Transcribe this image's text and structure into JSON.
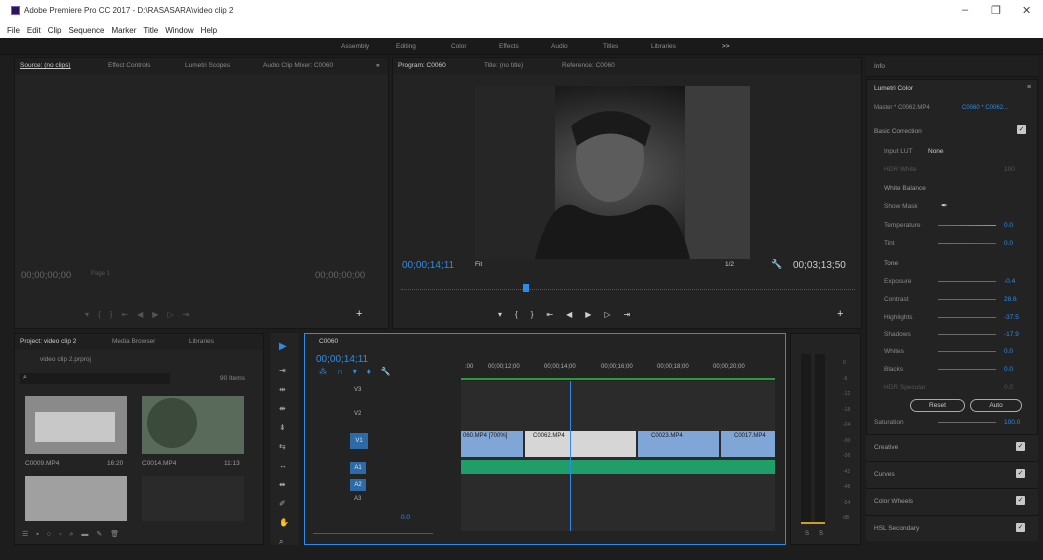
{
  "window": {
    "title": "Adobe Premiere Pro CC 2017 - D:\\RASASARA\\video clip 2",
    "minimize": "–",
    "maximize": "❐",
    "close": "✕"
  },
  "menu": [
    "File",
    "Edit",
    "Clip",
    "Sequence",
    "Marker",
    "Title",
    "Window",
    "Help"
  ],
  "workspaces": [
    "Assembly",
    "Editing",
    "Color",
    "Effects",
    "Audio",
    "Titles",
    "Libraries",
    ">>"
  ],
  "source": {
    "tabs": [
      "Source: (no clips)",
      "Effect Controls",
      "Lumetri Scopes",
      "Audio Clip Mixer: C0060"
    ],
    "tc_left": "00;00;00;00",
    "tc_right": "00;00;00;00",
    "page": "Page 1"
  },
  "program": {
    "tab": "Program: C0060",
    "title": "Title: (no title)",
    "ref": "Reference: C0060",
    "tc": "00;00;14;11",
    "fit": "Fit",
    "res": "1/2",
    "duration": "00;03;13;50"
  },
  "project": {
    "tabs": [
      "Project: video clip 2",
      "Media Browser",
      "Libraries"
    ],
    "file": "video clip 2.prproj",
    "count": "90 Items",
    "clips": [
      {
        "name": "C0009.MP4",
        "dur": "16:20"
      },
      {
        "name": "C0014.MP4",
        "dur": "11:13"
      }
    ]
  },
  "timeline": {
    "tab": "C0060",
    "tc": "00;00;14;11",
    "ruler": [
      ":00",
      "00;00;12;00",
      "00;00;14;00",
      "00;00;16;00",
      "00;00;18;00",
      "00;00;20;00"
    ],
    "video_tracks": [
      "V3",
      "V2",
      "V1"
    ],
    "audio_tracks": [
      "A1",
      "A2",
      "A3"
    ],
    "master": "0.0",
    "clips": [
      "060.MP4 [700%]",
      "C0062.MP4",
      "C0023.MP4",
      "C0017.MP4"
    ]
  },
  "meter": {
    "ticks": [
      "0",
      "-6",
      "-12",
      "-18",
      "-24",
      "-30",
      "-36",
      "-42",
      "-48",
      "-54",
      "dB"
    ],
    "solo": [
      "S",
      "S"
    ]
  },
  "lumetri": {
    "info": "Info",
    "panel": "Lumetri Color",
    "master": "Master * C0062.MP4",
    "clip": "C0060 * C0062...",
    "basic": "Basic Correction",
    "lut_label": "Input LUT",
    "lut": "None",
    "hdr": "HDR White",
    "hdr_val": "100",
    "wb": "White Balance",
    "show_mask": "Show Mask",
    "temp": "Temperature",
    "temp_val": "0.0",
    "tint": "Tint",
    "tint_val": "0.0",
    "tone": "Tone",
    "exposure": "Exposure",
    "exposure_val": "-0.4",
    "contrast": "Contrast",
    "contrast_val": "28.6",
    "highlights": "Highlights",
    "highlights_val": "-37.5",
    "shadows": "Shadows",
    "shadows_val": "-17.9",
    "whites": "Whites",
    "whites_val": "0.0",
    "blacks": "Blacks",
    "blacks_val": "0.0",
    "hdr_spec": "HDR Specular",
    "hdr_spec_val": "0.0",
    "reset": "Reset",
    "auto": "Auto",
    "saturation": "Saturation",
    "saturation_val": "100.0",
    "creative": "Creative",
    "curves": "Curves",
    "wheels": "Color Wheels",
    "hsl": "HSL Secondary"
  },
  "colors": {
    "accent": "#2d8ceb",
    "audio": "#1f9e6a",
    "video": "#7fa6d6",
    "clip_selected": "#d6d6d6"
  }
}
